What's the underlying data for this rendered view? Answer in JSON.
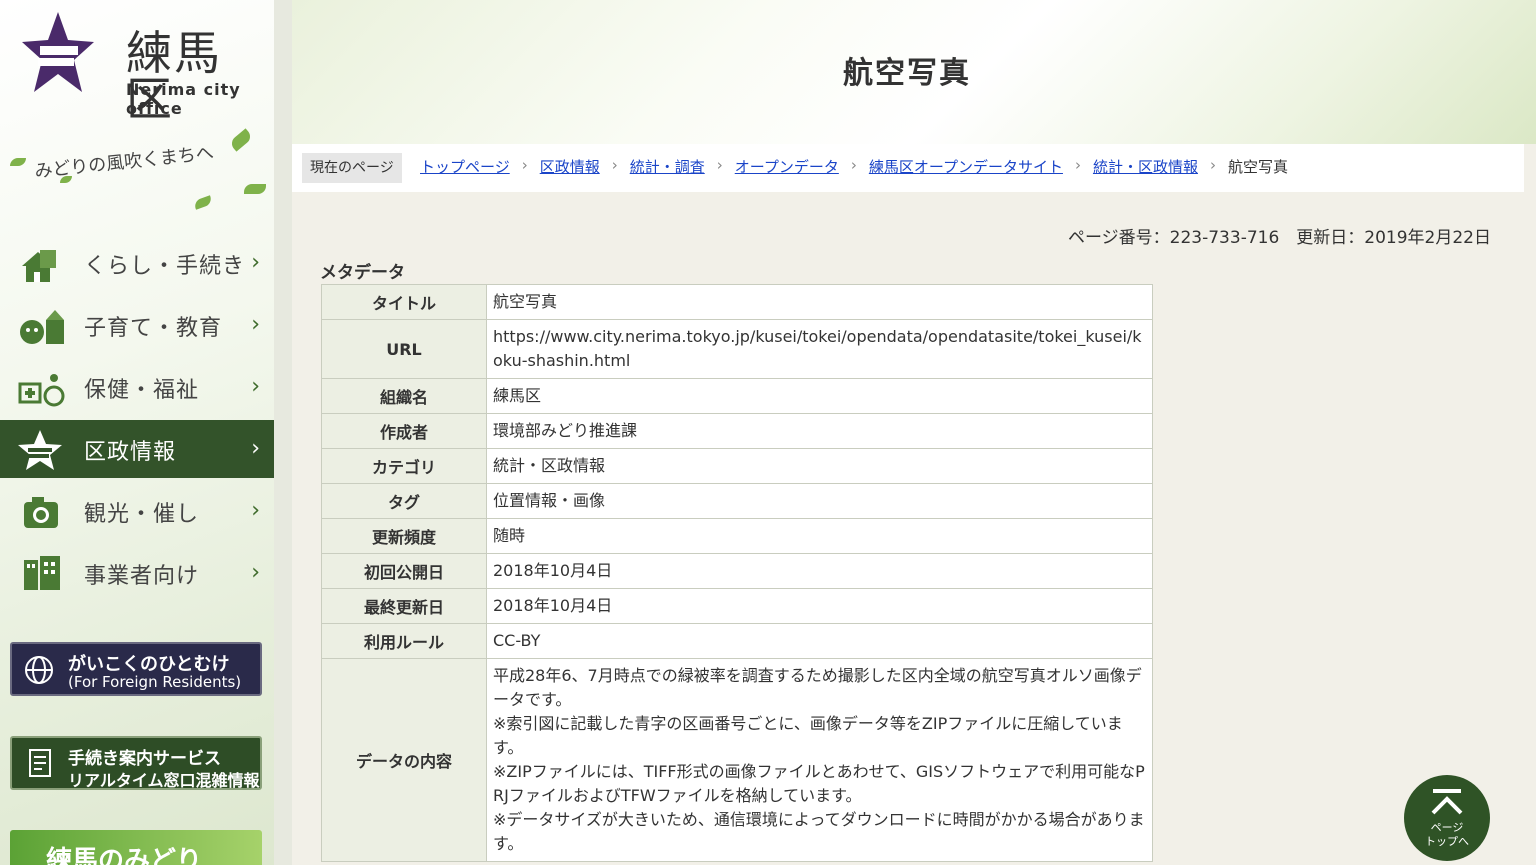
{
  "logo": {
    "ja": "練馬区",
    "en": "Nerima city office"
  },
  "slogan": "みどりの風吹くまちへ",
  "nav": {
    "items": [
      {
        "label": "くらし・手続き",
        "icon": "house-icon"
      },
      {
        "label": "子育て・教育",
        "icon": "child-icon"
      },
      {
        "label": "保健・福祉",
        "icon": "health-icon"
      },
      {
        "label": "区政情報",
        "icon": "city-emblem-icon"
      },
      {
        "label": "観光・催し",
        "icon": "camera-icon"
      },
      {
        "label": "事業者向け",
        "icon": "building-icon"
      }
    ]
  },
  "banners": {
    "foreign": {
      "line1": "がいこくのひとむけ",
      "line2": "(For Foreign Residents)"
    },
    "service": {
      "line1": "手続き案内サービス",
      "line2": "リアルタイム窓口混雑情報"
    },
    "green": "練馬のみどり"
  },
  "header": {
    "title": "航空写真"
  },
  "breadcrumb": {
    "current_label": "現在のページ",
    "links": [
      "トップページ",
      "区政情報",
      "統計・調査",
      "オープンデータ",
      "練馬区オープンデータサイト",
      "統計・区政情報"
    ],
    "last": "航空写真"
  },
  "meta_line": "ページ番号：223-733-716　更新日：2019年2月22日",
  "metadata": {
    "heading": "メタデータ",
    "rows": [
      {
        "label": "タイトル",
        "value": "航空写真"
      },
      {
        "label": "URL",
        "value": "https://www.city.nerima.tokyo.jp/kusei/tokei/opendata/opendatasite/tokei_kusei/koku-shashin.html"
      },
      {
        "label": "組織名",
        "value": "練馬区"
      },
      {
        "label": "作成者",
        "value": "環境部みどり推進課"
      },
      {
        "label": "カテゴリ",
        "value": "統計・区政情報"
      },
      {
        "label": "タグ",
        "value": "位置情報・画像"
      },
      {
        "label": "更新頻度",
        "value": "随時"
      },
      {
        "label": "初回公開日",
        "value": "2018年10月4日"
      },
      {
        "label": "最終更新日",
        "value": "2018年10月4日"
      },
      {
        "label": "利用ルール",
        "value": "CC-BY"
      },
      {
        "label": "データの内容",
        "lines": [
          "平成28年6、7月時点での緑被率を調査するため撮影した区内全域の航空写真オルソ画像データです。",
          "※索引図に記載した青字の区画番号ごとに、画像データ等をZIPファイルに圧縮しています。",
          "※ZIPファイルには、TIFF形式の画像ファイルとあわせて、GISソフトウェアで利用可能なPRJファイルおよびTFWファイルを格納しています。",
          "※データサイズが大きいため、通信環境によってダウンロードに時間がかかる場合があります。"
        ]
      }
    ]
  },
  "page_top": {
    "line1": "ページ",
    "line2": "トップへ"
  }
}
